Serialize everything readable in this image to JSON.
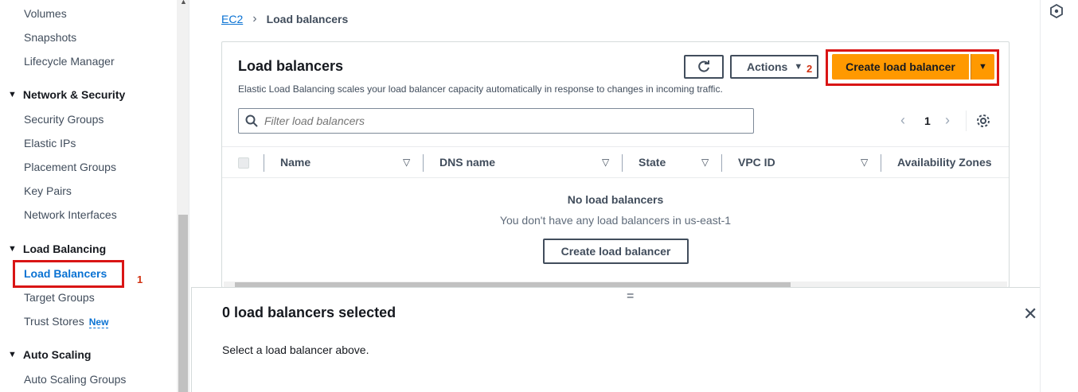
{
  "sidebar": {
    "items": [
      {
        "label": "Volumes"
      },
      {
        "label": "Snapshots"
      },
      {
        "label": "Lifecycle Manager"
      }
    ],
    "sections": [
      {
        "label": "Network & Security",
        "items": [
          "Security Groups",
          "Elastic IPs",
          "Placement Groups",
          "Key Pairs",
          "Network Interfaces"
        ]
      },
      {
        "label": "Load Balancing",
        "items": [
          "Load Balancers",
          "Target Groups",
          "Trust Stores"
        ]
      },
      {
        "label": "Auto Scaling",
        "items": [
          "Auto Scaling Groups"
        ]
      }
    ],
    "new_badge": "New",
    "active_item": "Load Balancers"
  },
  "annotations": {
    "step1": "1",
    "step2": "2"
  },
  "breadcrumb": {
    "root": "EC2",
    "current": "Load balancers"
  },
  "panel": {
    "title": "Load balancers",
    "description": "Elastic Load Balancing scales your load balancer capacity automatically in response to changes in incoming traffic.",
    "actions_label": "Actions",
    "create_label": "Create load balancer",
    "search_placeholder": "Filter load balancers",
    "page_number": "1",
    "columns": [
      "Name",
      "DNS name",
      "State",
      "VPC ID",
      "Availability Zones"
    ],
    "empty_title": "No load balancers",
    "empty_subtitle": "You don't have any load balancers in us-east-1",
    "empty_create_label": "Create load balancer"
  },
  "split_panel": {
    "title": "0 load balancers selected",
    "body": "Select a load balancer above."
  },
  "colors": {
    "primary_button": "#ff9900",
    "link": "#0972d3",
    "highlight": "#d91515"
  }
}
